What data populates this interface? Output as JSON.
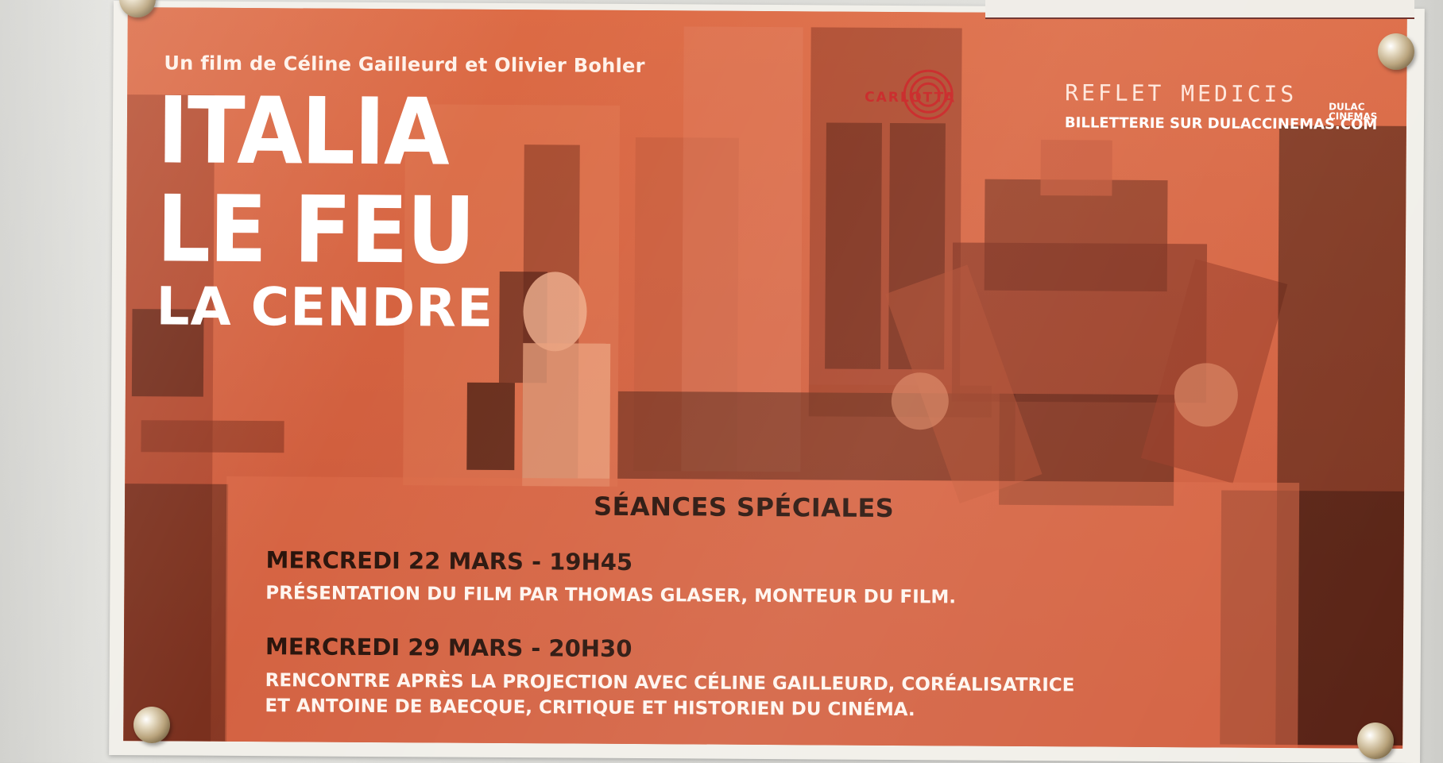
{
  "poster": {
    "credit": "Un film de Céline Gailleurd et Olivier Bohler",
    "title_line1": "ITALIA",
    "title_line2": "LE FEU",
    "title_line3": "LA CENDRE",
    "distributor_logo": "CARLOTTA",
    "cinema_name": "REFLET MEDICIS",
    "cinema_group": "DULAC CINEMAS",
    "ticketing": "BILLETTERIE SUR DULACCINEMAS.COM",
    "screenings_heading": "SÉANCES SPÉCIALES",
    "screenings": [
      {
        "date": "MERCREDI 22 MARS - 19H45",
        "description": [
          "PRÉSENTATION DU FILM PAR THOMAS GLASER, MONTEUR DU FILM."
        ]
      },
      {
        "date": "MERCREDI 29 MARS - 20H30",
        "description": [
          "RENCONTRE APRÈS LA PROJECTION AVEC CÉLINE GAILLEURD, CORÉALISATRICE",
          "ET ANTOINE DE BAECQUE, CRITIQUE ET HISTORIEN DU CINÉMA."
        ]
      }
    ]
  },
  "colors": {
    "poster_orange": "#d9653f",
    "photo_dark": "#4a1a10",
    "carlotta_red": "#c82222",
    "heading_dark": "#2a140c"
  }
}
